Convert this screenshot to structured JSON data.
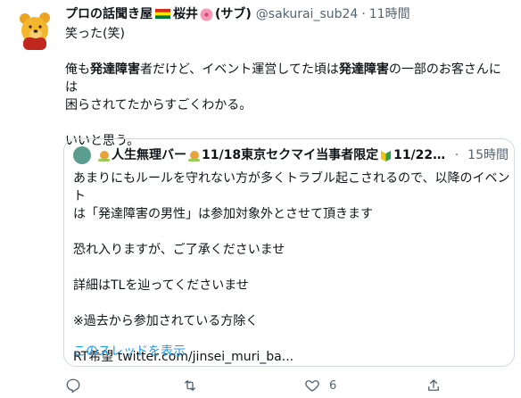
{
  "tweet": {
    "display_name_part1": "プロの話聞き屋",
    "display_name_part2": "桜井",
    "display_name_part3": "(サブ)",
    "handle": "@sakurai_sub24",
    "separator": "·",
    "time": "11時間",
    "text": {
      "line1": "笑った(笑)",
      "line2_a": "俺も",
      "line2_b": "発達障害",
      "line2_c": "者だけど、イベント運営してた頃は",
      "line2_d": "発達障害",
      "line2_e": "の一部のお客さんには",
      "line3": "困らされてたからすごくわかる。",
      "line4": "いいと思う。"
    }
  },
  "quote": {
    "name_part1": "人生無理バー",
    "name_part2": "11/18東京セクマイ当事者限定",
    "name_part3": "11/22東...",
    "separator": "·",
    "time": "15時間",
    "lines": [
      "あまりにもルールを守れない方が多くトラブル起こされるので、以降のイベント",
      "は「発達障害の男性」は参加対象外とさせて頂きます",
      "恐れ入りますが、ご了承くださいませ",
      "詳細はTLを辿ってくださいませ",
      "※過去から参加されている方除く",
      "RT希望 twitter.com/jinsei_muri_ba..."
    ],
    "thread_link": "このスレッドを表示"
  },
  "actions": {
    "like_count": "6"
  },
  "colors": {
    "text": "#0f1419",
    "muted": "#536471",
    "link": "#1d9bf0",
    "border": "#cfd9de"
  },
  "icons": [
    "winnie-the-pooh-avatar",
    "bolivia-flag",
    "hibiscus-emoji",
    "snail-emoji",
    "beginner-mark-emoji",
    "reply-icon",
    "retweet-icon",
    "like-icon",
    "share-icon"
  ]
}
